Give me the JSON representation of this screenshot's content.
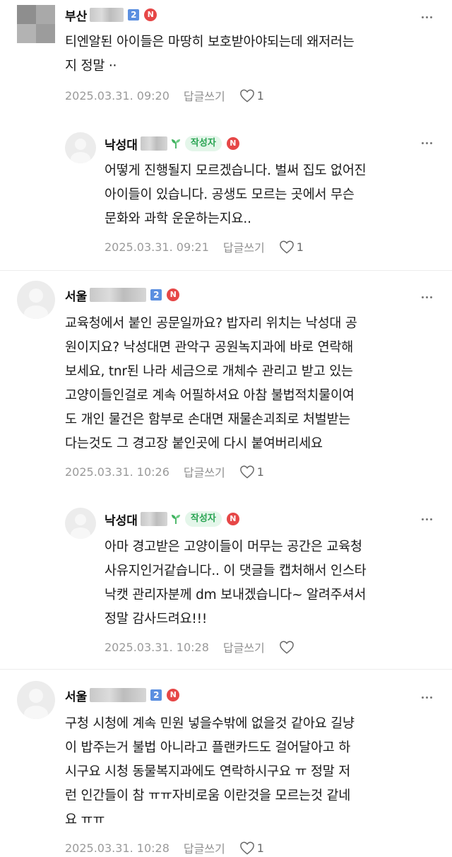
{
  "comments": [
    {
      "author": "부산",
      "level": "2",
      "new_badge": "N",
      "lines": [
        "티엔알된 아이들은 마땅히 보호받아야되는데 왜저러는",
        "지 정말 ··"
      ],
      "date": "2025.03.31. 09:20",
      "reply": "답글쓰기",
      "likes": "1"
    },
    {
      "author": "낙성대",
      "author_tag": "작성자",
      "new_badge": "N",
      "lines": [
        "어떻게 진행될지 모르겠습니다. 벌써 집도 없어진",
        "아이들이 있습니다. 공생도 모르는 곳에서 무슨",
        "문화와 과학 운운하는지요.."
      ],
      "date": "2025.03.31. 09:21",
      "reply": "답글쓰기",
      "likes": "1"
    },
    {
      "author": "서울",
      "level": "2",
      "new_badge": "N",
      "lines": [
        "교육청에서 붙인 공문일까요? 밥자리 위치는 낙성대 공",
        "원이지요? 낙성대면 관악구 공원녹지과에 바로 연락해",
        "보세요, tnr된 나라 세금으로 개체수 관리고 받고 있는",
        "고양이들인걸로 계속 어필하셔요 아참 불법적치물이여",
        "도 개인 물건은 함부로 손대면 재물손괴죄로 처벌받는",
        "다는것도 그 경고장 붙인곳에 다시 붙여버리세요"
      ],
      "date": "2025.03.31. 10:26",
      "reply": "답글쓰기",
      "likes": "1"
    },
    {
      "author": "낙성대",
      "author_tag": "작성자",
      "new_badge": "N",
      "lines": [
        "아마 경고받은 고양이들이 머무는 공간은 교육청",
        "사유지인거같습니다.. 이 댓글들 캡처해서 인스타",
        "낙캣 관리자분께 dm 보내겠습니다~ 알려주셔서",
        "정말 감사드려요!!!"
      ],
      "date": "2025.03.31. 10:28",
      "reply": "답글쓰기",
      "likes": ""
    },
    {
      "author": "서울",
      "level": "2",
      "new_badge": "N",
      "lines": [
        "구청 시청에 계속 민원 넣을수밖에 없을것 같아요 길냥",
        "이 밥주는거 불법 아니라고 플랜카드도 걸어달아고 하",
        "시구요 시청 동물복지과에도 연락하시구요 ㅠ 정말 저",
        "런 인간들이 참 ㅠㅠ자비로움 이란것을 모르는것 같네",
        "요 ㅠㅠ"
      ],
      "date": "2025.03.31. 10:28",
      "reply": "답글쓰기",
      "likes": "1"
    }
  ]
}
